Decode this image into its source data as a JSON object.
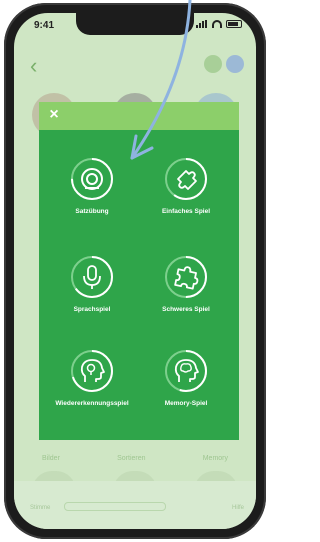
{
  "status_bar": {
    "time": "9:41"
  },
  "background": {
    "labels": [
      "Bilder",
      "Sortieren",
      "Memory"
    ],
    "bottom_left": "Stimme",
    "bottom_right": "Hilfe"
  },
  "modal": {
    "close_label": "×",
    "tiles": [
      {
        "label": "Satzübung",
        "icon": "target-icon",
        "progress": 0.75
      },
      {
        "label": "Einfaches Spiel",
        "icon": "puzzle-piece-icon",
        "progress": 0.6
      },
      {
        "label": "Sprachspiel",
        "icon": "microphone-icon",
        "progress": 0.65
      },
      {
        "label": "Schweres Spiel",
        "icon": "puzzle-piece-icon",
        "progress": 0.5
      },
      {
        "label": "Wiedererkennungsspiel",
        "icon": "brain-head-icon",
        "progress": 0.7
      },
      {
        "label": "Memory-Spiel",
        "icon": "brain-head-icon",
        "progress": 0.55
      }
    ]
  },
  "colors": {
    "modal_green": "#2fa54a",
    "modal_header": "#8ccf6a",
    "arrow": "#8eb3e0"
  }
}
